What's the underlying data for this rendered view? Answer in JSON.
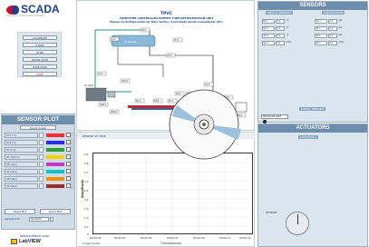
{
  "brand": {
    "logo_text": "SCADA",
    "subtitle": "Supervision Control & Data Acquisition"
  },
  "left_buttons": [
    "CALIBRATE",
    "START",
    "STOP",
    "SHOW DATA",
    "SAVE DATA",
    "QUIT"
  ],
  "diagram": {
    "title": "TPVC",
    "subtitle1": "COMPUTER CONTROLLED VORTEX TUBE REFRIGERATION UNIT",
    "subtitle2": "Equipo de Refrigeración de Tubo Vortex, Controlado desde Computador (PC)",
    "labels": [
      "CV-1",
      "ST-2",
      "ST-1",
      "CV-5",
      "ST-3",
      "ST-4",
      "ST-5",
      "SC-1",
      "ST-6",
      "ST-7",
      "PS-1",
      "AVR-1",
      "AVR-2",
      "AVR-3",
      "EX-1",
      "EX-2"
    ],
    "air_label": "Air input",
    "vortex_label": "Vortex tube"
  },
  "sensors": {
    "title": "SENSORS",
    "col1_header": "ANALOG SENSORS",
    "col2_header": "CALCULATIONS",
    "analog": [
      {
        "tag": "ST-1",
        "value": "0.0",
        "unit": "ºC"
      },
      {
        "tag": "ST-2",
        "value": "0.0",
        "unit": "ºC"
      },
      {
        "tag": "ST-3",
        "value": "0.0",
        "unit": "ºC"
      },
      {
        "tag": "SC-1",
        "value": "0.0",
        "unit": "l/min"
      }
    ],
    "calc": [
      {
        "tag": "ST-4",
        "value": "0.0",
        "unit": "bar"
      },
      {
        "tag": "ST-5",
        "value": "0.0",
        "unit": "bar"
      },
      {
        "tag": "ST-6",
        "value": "0.0",
        "unit": "bar"
      },
      {
        "tag": "ST-7",
        "value": "0.0",
        "unit": "l/min"
      }
    ],
    "digital_header": "DIGITAL SENSORS",
    "digital": {
      "tag": "PRESSURE LIMIT",
      "state": "off"
    }
  },
  "actuators": {
    "title": "ACTUATORS",
    "subheader": "ACTUATOR A",
    "knob_label": "SETPOINT"
  },
  "sensor_plot": {
    "title": "SENSOR PLOT",
    "mode": "Single Graph",
    "rows": [
      {
        "label": "ST-1(ºC)",
        "color": "#ff2a2a"
      },
      {
        "label": "ST-2(ºC)",
        "color": "#2a2aff"
      },
      {
        "label": "ST-3(ºC)",
        "color": "#2aa02a"
      },
      {
        "label": "SC-1(l/min)",
        "color": "#ffd000"
      },
      {
        "label": "SP-1(bar)",
        "color": "#cc33cc"
      },
      {
        "label": "SP-2(bar)",
        "color": "#00c6c6"
      },
      {
        "label": "SP-3(bar)",
        "color": "#ff8c00"
      },
      {
        "label": "SP-4(bar)",
        "color": "#a02a2a"
      }
    ],
    "reset_label": "Reset Plot",
    "zoom_label": "Zoom Plot",
    "sample_label": "Sample Plot",
    "sample_value": "00:00:00"
  },
  "graph": {
    "header": "SENSOR VS TIME",
    "ylabel": "Amplitude",
    "xlabel": "Time(seconds)",
    "yticks": [
      "0.9",
      "0.8",
      "0.7",
      "0.6",
      "0.5",
      "0.4",
      "0.3",
      "0.2",
      "0.1",
      "0"
    ],
    "xticks": [
      "00:00:00",
      "00:00:02",
      "00:00:05",
      "00:00:07",
      "00:00:09",
      "00:00:12",
      "00:00:14"
    ],
    "footer": "Single Graph"
  },
  "footer": {
    "url": "www.edibon.com",
    "labview": "LabVIEW"
  }
}
